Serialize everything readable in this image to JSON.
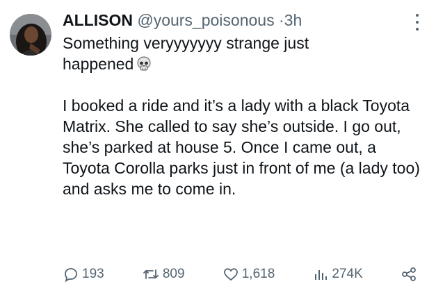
{
  "tweet": {
    "author_name": "ALLISON",
    "handle": "@yours_poisonous",
    "separator": "·",
    "time": "3h",
    "line1": "Something veryyyyyyy strange just",
    "line2": "happened",
    "emoji_icon": "skull-icon",
    "paragraph2": "I booked a ride and it’s a lady with a black Toyota Matrix. She called to say she’s outside. I go out, she’s parked at house 5. Once I came out, a Toyota Corolla parks just in front of me (a lady too) and asks me to come in."
  },
  "actions": {
    "replies": "193",
    "retweets": "809",
    "likes": "1,618",
    "views": "274K"
  },
  "colors": {
    "text": "#0f1419",
    "muted": "#536471"
  }
}
